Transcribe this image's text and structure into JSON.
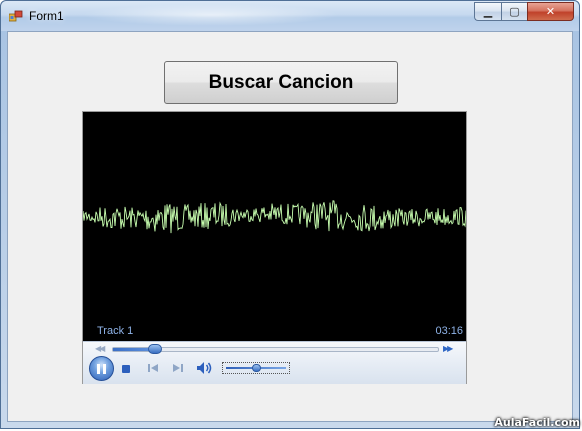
{
  "window": {
    "title": "Form1",
    "minimize_icon": "minimize-icon",
    "maximize_icon": "maximize-icon",
    "close_icon": "close-icon",
    "minimize_glyph": "▁",
    "maximize_glyph": "▢",
    "close_glyph": "✕"
  },
  "main": {
    "search_button_label": "Buscar Cancion"
  },
  "player": {
    "track_title": "Track 1",
    "elapsed_time": "03:16",
    "seek_progress": 0.13,
    "volume_level": 0.5,
    "state": "playing",
    "colors": {
      "accent": "#2c5fbd",
      "waveform": "#c8ffb0",
      "text": "#8fb3e8"
    }
  },
  "watermark": "AulaFacil.com"
}
